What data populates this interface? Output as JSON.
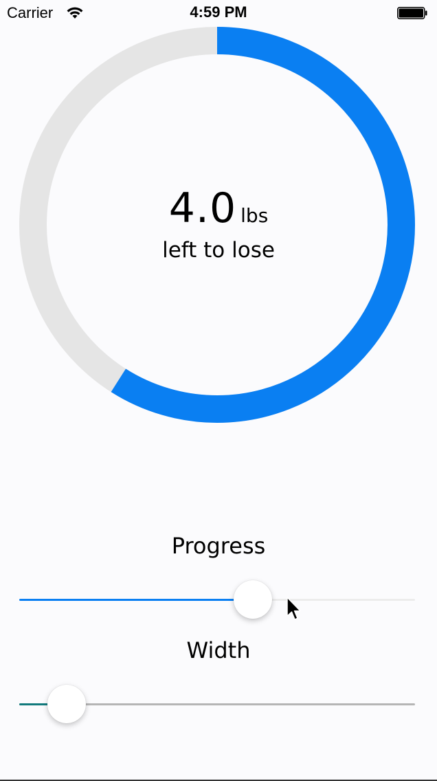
{
  "status_bar": {
    "carrier": "Carrier",
    "time": "4:59 PM"
  },
  "ring": {
    "value": "4.0",
    "unit": "lbs",
    "caption": "left to lose",
    "progress_fraction": 0.59,
    "track_color": "#e5e5e5",
    "progress_color": "#0a7ff2"
  },
  "sliders": {
    "progress": {
      "label": "Progress",
      "value_fraction": 0.59,
      "fill_color": "#0a7ff2",
      "track_color": "#ececec"
    },
    "width": {
      "label": "Width",
      "value_fraction": 0.12,
      "fill_color": "#117a7c",
      "track_color": "#b5b5b5"
    }
  },
  "icons": [
    "wifi-icon",
    "battery-icon",
    "cursor-icon"
  ]
}
